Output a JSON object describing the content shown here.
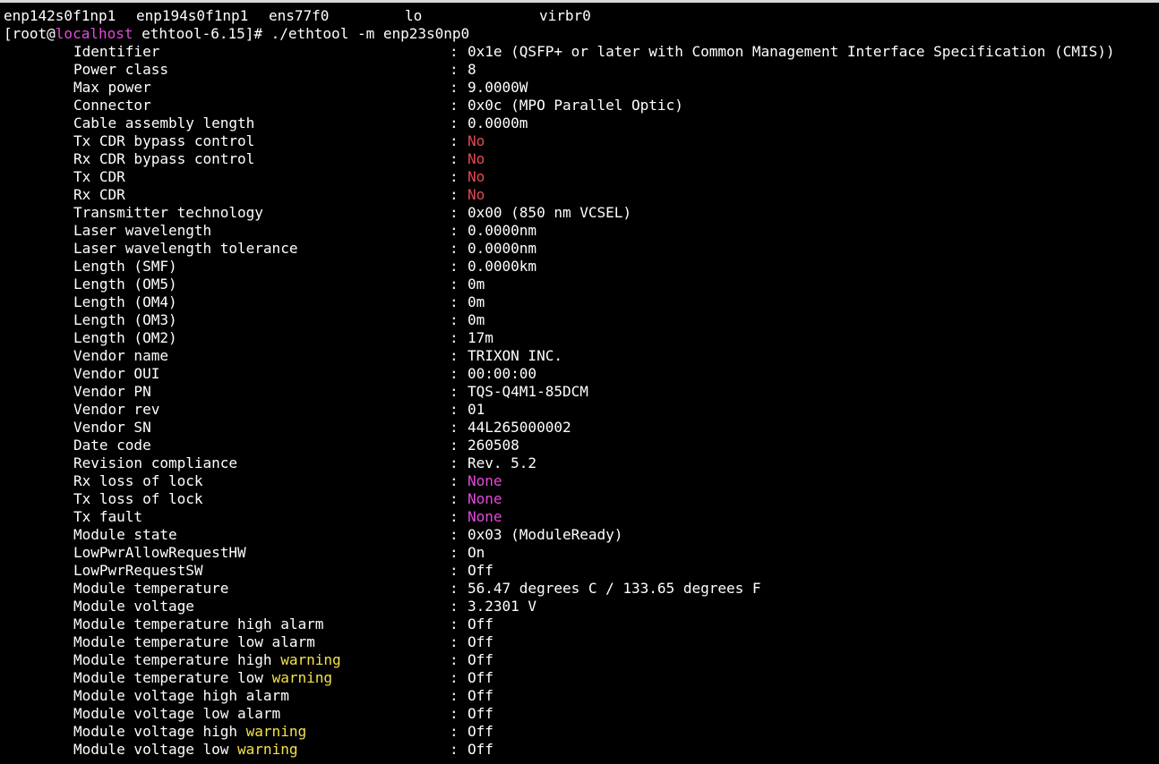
{
  "interfaces": [
    "enp142s0f1np1",
    "enp194s0f1np1",
    "ens77f0",
    "lo",
    "virbr0"
  ],
  "prompt": {
    "open": "[root@",
    "host": "localhost",
    "rest": " ethtool-6.15]# ./ethtool -m enp23s0np0"
  },
  "colors": {
    "red": "#e74856",
    "magenta": "#e34adc",
    "yellow": "#f3e24a"
  },
  "separator": ":",
  "rows": [
    {
      "label": "Identifier",
      "value": "0x1e (QSFP+ or later with Common Management Interface Specification (CMIS))",
      "color": "white"
    },
    {
      "label": "Power class",
      "value": "8",
      "color": "white"
    },
    {
      "label": "Max power",
      "value": "9.0000W",
      "color": "white"
    },
    {
      "label": "Connector",
      "value": "0x0c (MPO Parallel Optic)",
      "color": "white"
    },
    {
      "label": "Cable assembly length",
      "value": "0.0000m",
      "color": "white"
    },
    {
      "label": "Tx CDR bypass control",
      "value": "No",
      "color": "red"
    },
    {
      "label": "Rx CDR bypass control",
      "value": "No",
      "color": "red"
    },
    {
      "label": "Tx CDR",
      "value": "No",
      "color": "red"
    },
    {
      "label": "Rx CDR",
      "value": "No",
      "color": "red"
    },
    {
      "label": "Transmitter technology",
      "value": "0x00 (850 nm VCSEL)",
      "color": "white"
    },
    {
      "label": "Laser wavelength",
      "value": "0.0000nm",
      "color": "white"
    },
    {
      "label": "Laser wavelength tolerance",
      "value": "0.0000nm",
      "color": "white"
    },
    {
      "label": "Length (SMF)",
      "value": "0.0000km",
      "color": "white"
    },
    {
      "label": "Length (OM5)",
      "value": "0m",
      "color": "white"
    },
    {
      "label": "Length (OM4)",
      "value": "0m",
      "color": "white"
    },
    {
      "label": "Length (OM3)",
      "value": "0m",
      "color": "white"
    },
    {
      "label": "Length (OM2)",
      "value": "17m",
      "color": "white"
    },
    {
      "label": "Vendor name",
      "value": "TRIXON INC.",
      "color": "white"
    },
    {
      "label": "Vendor OUI",
      "value": "00:00:00",
      "color": "white"
    },
    {
      "label": "Vendor PN",
      "value": "TQS-Q4M1-85DCM",
      "color": "white"
    },
    {
      "label": "Vendor rev",
      "value": "01",
      "color": "white"
    },
    {
      "label": "Vendor SN",
      "value": "44L265000002",
      "color": "white"
    },
    {
      "label": "Date code",
      "value": "260508",
      "color": "white"
    },
    {
      "label": "Revision compliance",
      "value": "Rev. 5.2",
      "color": "white"
    },
    {
      "label": "Rx loss of lock",
      "value": "None",
      "color": "magenta"
    },
    {
      "label": "Tx loss of lock",
      "value": "None",
      "color": "magenta"
    },
    {
      "label": "Tx fault",
      "value": "None",
      "color": "magenta"
    },
    {
      "label": "Module state",
      "value": "0x03 (ModuleReady)",
      "color": "white"
    },
    {
      "label": "LowPwrAllowRequestHW",
      "value": "On",
      "color": "white"
    },
    {
      "label": "LowPwrRequestSW",
      "value": "Off",
      "color": "white"
    },
    {
      "label": "Module temperature",
      "value": "56.47 degrees C / 133.65 degrees F",
      "color": "white"
    },
    {
      "label": "Module voltage",
      "value": "3.2301 V",
      "color": "white"
    },
    {
      "label": "Module temperature high alarm",
      "value": "Off",
      "color": "white"
    },
    {
      "label": "Module temperature low alarm",
      "value": "Off",
      "color": "white"
    },
    {
      "label": "Module temperature high ",
      "highlight": "warning",
      "value": "Off",
      "color": "white"
    },
    {
      "label": "Module temperature low ",
      "highlight": "warning",
      "value": "Off",
      "color": "white"
    },
    {
      "label": "Module voltage high alarm",
      "value": "Off",
      "color": "white"
    },
    {
      "label": "Module voltage low alarm",
      "value": "Off",
      "color": "white"
    },
    {
      "label": "Module voltage high ",
      "highlight": "warning",
      "value": "Off",
      "color": "white"
    },
    {
      "label": "Module voltage low ",
      "highlight": "warning",
      "value": "Off",
      "color": "white"
    }
  ]
}
